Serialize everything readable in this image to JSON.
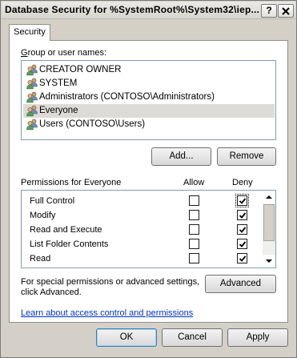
{
  "window": {
    "title": "Database Security for %SystemRoot%\\System32\\iep...",
    "help_button": "?",
    "close_button": "X"
  },
  "tabs": [
    {
      "label": "Security",
      "selected": true
    }
  ],
  "groups": {
    "label": "Group or user names:",
    "items": [
      {
        "label": "CREATOR OWNER",
        "selected": false,
        "icon": "users-icon"
      },
      {
        "label": "SYSTEM",
        "selected": false,
        "icon": "users-icon"
      },
      {
        "label": "Administrators (CONTOSO\\Administrators)",
        "selected": false,
        "icon": "users-icon"
      },
      {
        "label": "Everyone",
        "selected": true,
        "icon": "users-icon"
      },
      {
        "label": "Users (CONTOSO\\Users)",
        "selected": false,
        "icon": "users-icon"
      }
    ],
    "add_button": "Add...",
    "remove_button": "Remove"
  },
  "permissions": {
    "label": "Permissions for Everyone",
    "allow_header": "Allow",
    "deny_header": "Deny",
    "rows": [
      {
        "name": "Full Control",
        "allow": false,
        "deny": true
      },
      {
        "name": "Modify",
        "allow": false,
        "deny": true
      },
      {
        "name": "Read and Execute",
        "allow": false,
        "deny": true
      },
      {
        "name": "List Folder Contents",
        "allow": false,
        "deny": true
      },
      {
        "name": "Read",
        "allow": false,
        "deny": true
      }
    ]
  },
  "special": {
    "text_line1": "For special permissions or advanced settings,",
    "text_line2": "click Advanced.",
    "advanced_button": "Advanced"
  },
  "learn_link": "Learn about access control and permissions",
  "footer": {
    "ok_button": "OK",
    "cancel_button": "Cancel",
    "apply_button": "Apply"
  },
  "colors": {
    "window_bg": "#d4d0c8",
    "selected_item": "#dddbd6",
    "link": "#0033cc"
  }
}
